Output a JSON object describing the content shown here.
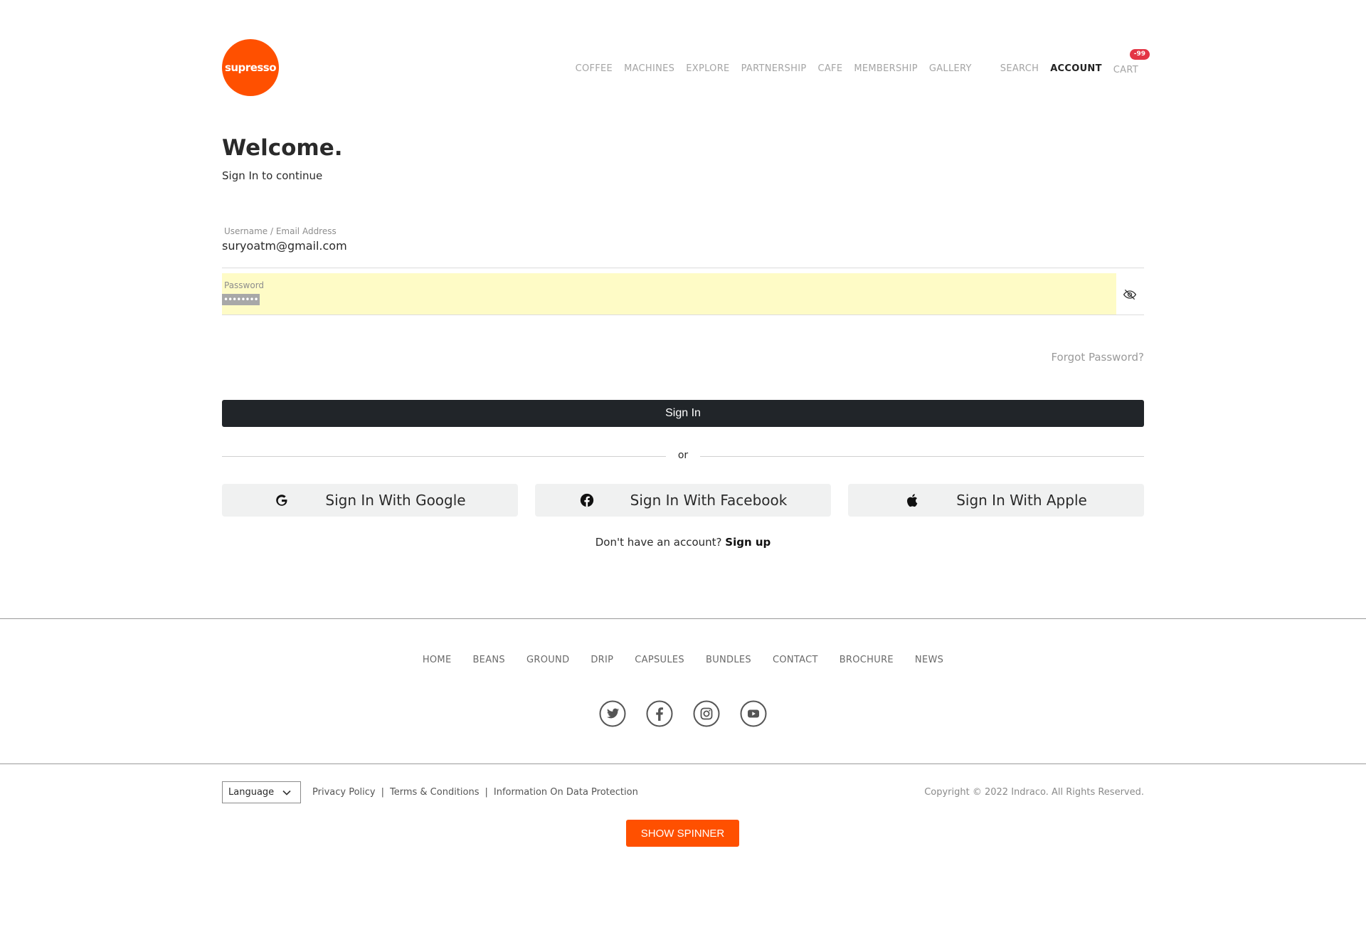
{
  "header": {
    "logo_text": "supresso",
    "nav": [
      "COFFEE",
      "MACHINES",
      "EXPLORE",
      "PARTNERSHIP",
      "CAFE",
      "MEMBERSHIP",
      "GALLERY"
    ],
    "search_label": "SEARCH",
    "account_label": "ACCOUNT",
    "cart_label": "CART",
    "cart_badge": "-99"
  },
  "main": {
    "title": "Welcome.",
    "subtitle": "Sign In to continue",
    "username_label": "Username / Email Address",
    "username_value": "suryoatm@gmail.com",
    "password_label": "Password",
    "password_value": "••••••••",
    "forgot_label": "Forgot Password?",
    "signin_label": "Sign In",
    "or_label": "or",
    "google_label": "Sign In With Google",
    "facebook_label": "Sign In With Facebook",
    "apple_label": "Sign In With Apple",
    "signup_prompt": "Don't have an account?",
    "signup_link": "Sign up"
  },
  "footer": {
    "nav": [
      "HOME",
      "BEANS",
      "GROUND",
      "DRIP",
      "CAPSULES",
      "BUNDLES",
      "CONTACT",
      "BROCHURE",
      "NEWS"
    ],
    "social_icons": [
      "twitter-icon",
      "facebook-icon",
      "instagram-icon",
      "youtube-icon"
    ],
    "language_label": "Language",
    "privacy_label": "Privacy Policy",
    "terms_label": "Terms & Conditions",
    "data_protection_label": "Information On Data Protection",
    "copyright": "Copyright © 2022 Indraco. All Rights Reserved."
  },
  "spinner_button_label": "SHOW SPINNER",
  "colors": {
    "brand_orange": "#ff5000",
    "dark_button": "#212529",
    "autofill_yellow": "#fefbc6",
    "badge_red": "#e33545"
  }
}
